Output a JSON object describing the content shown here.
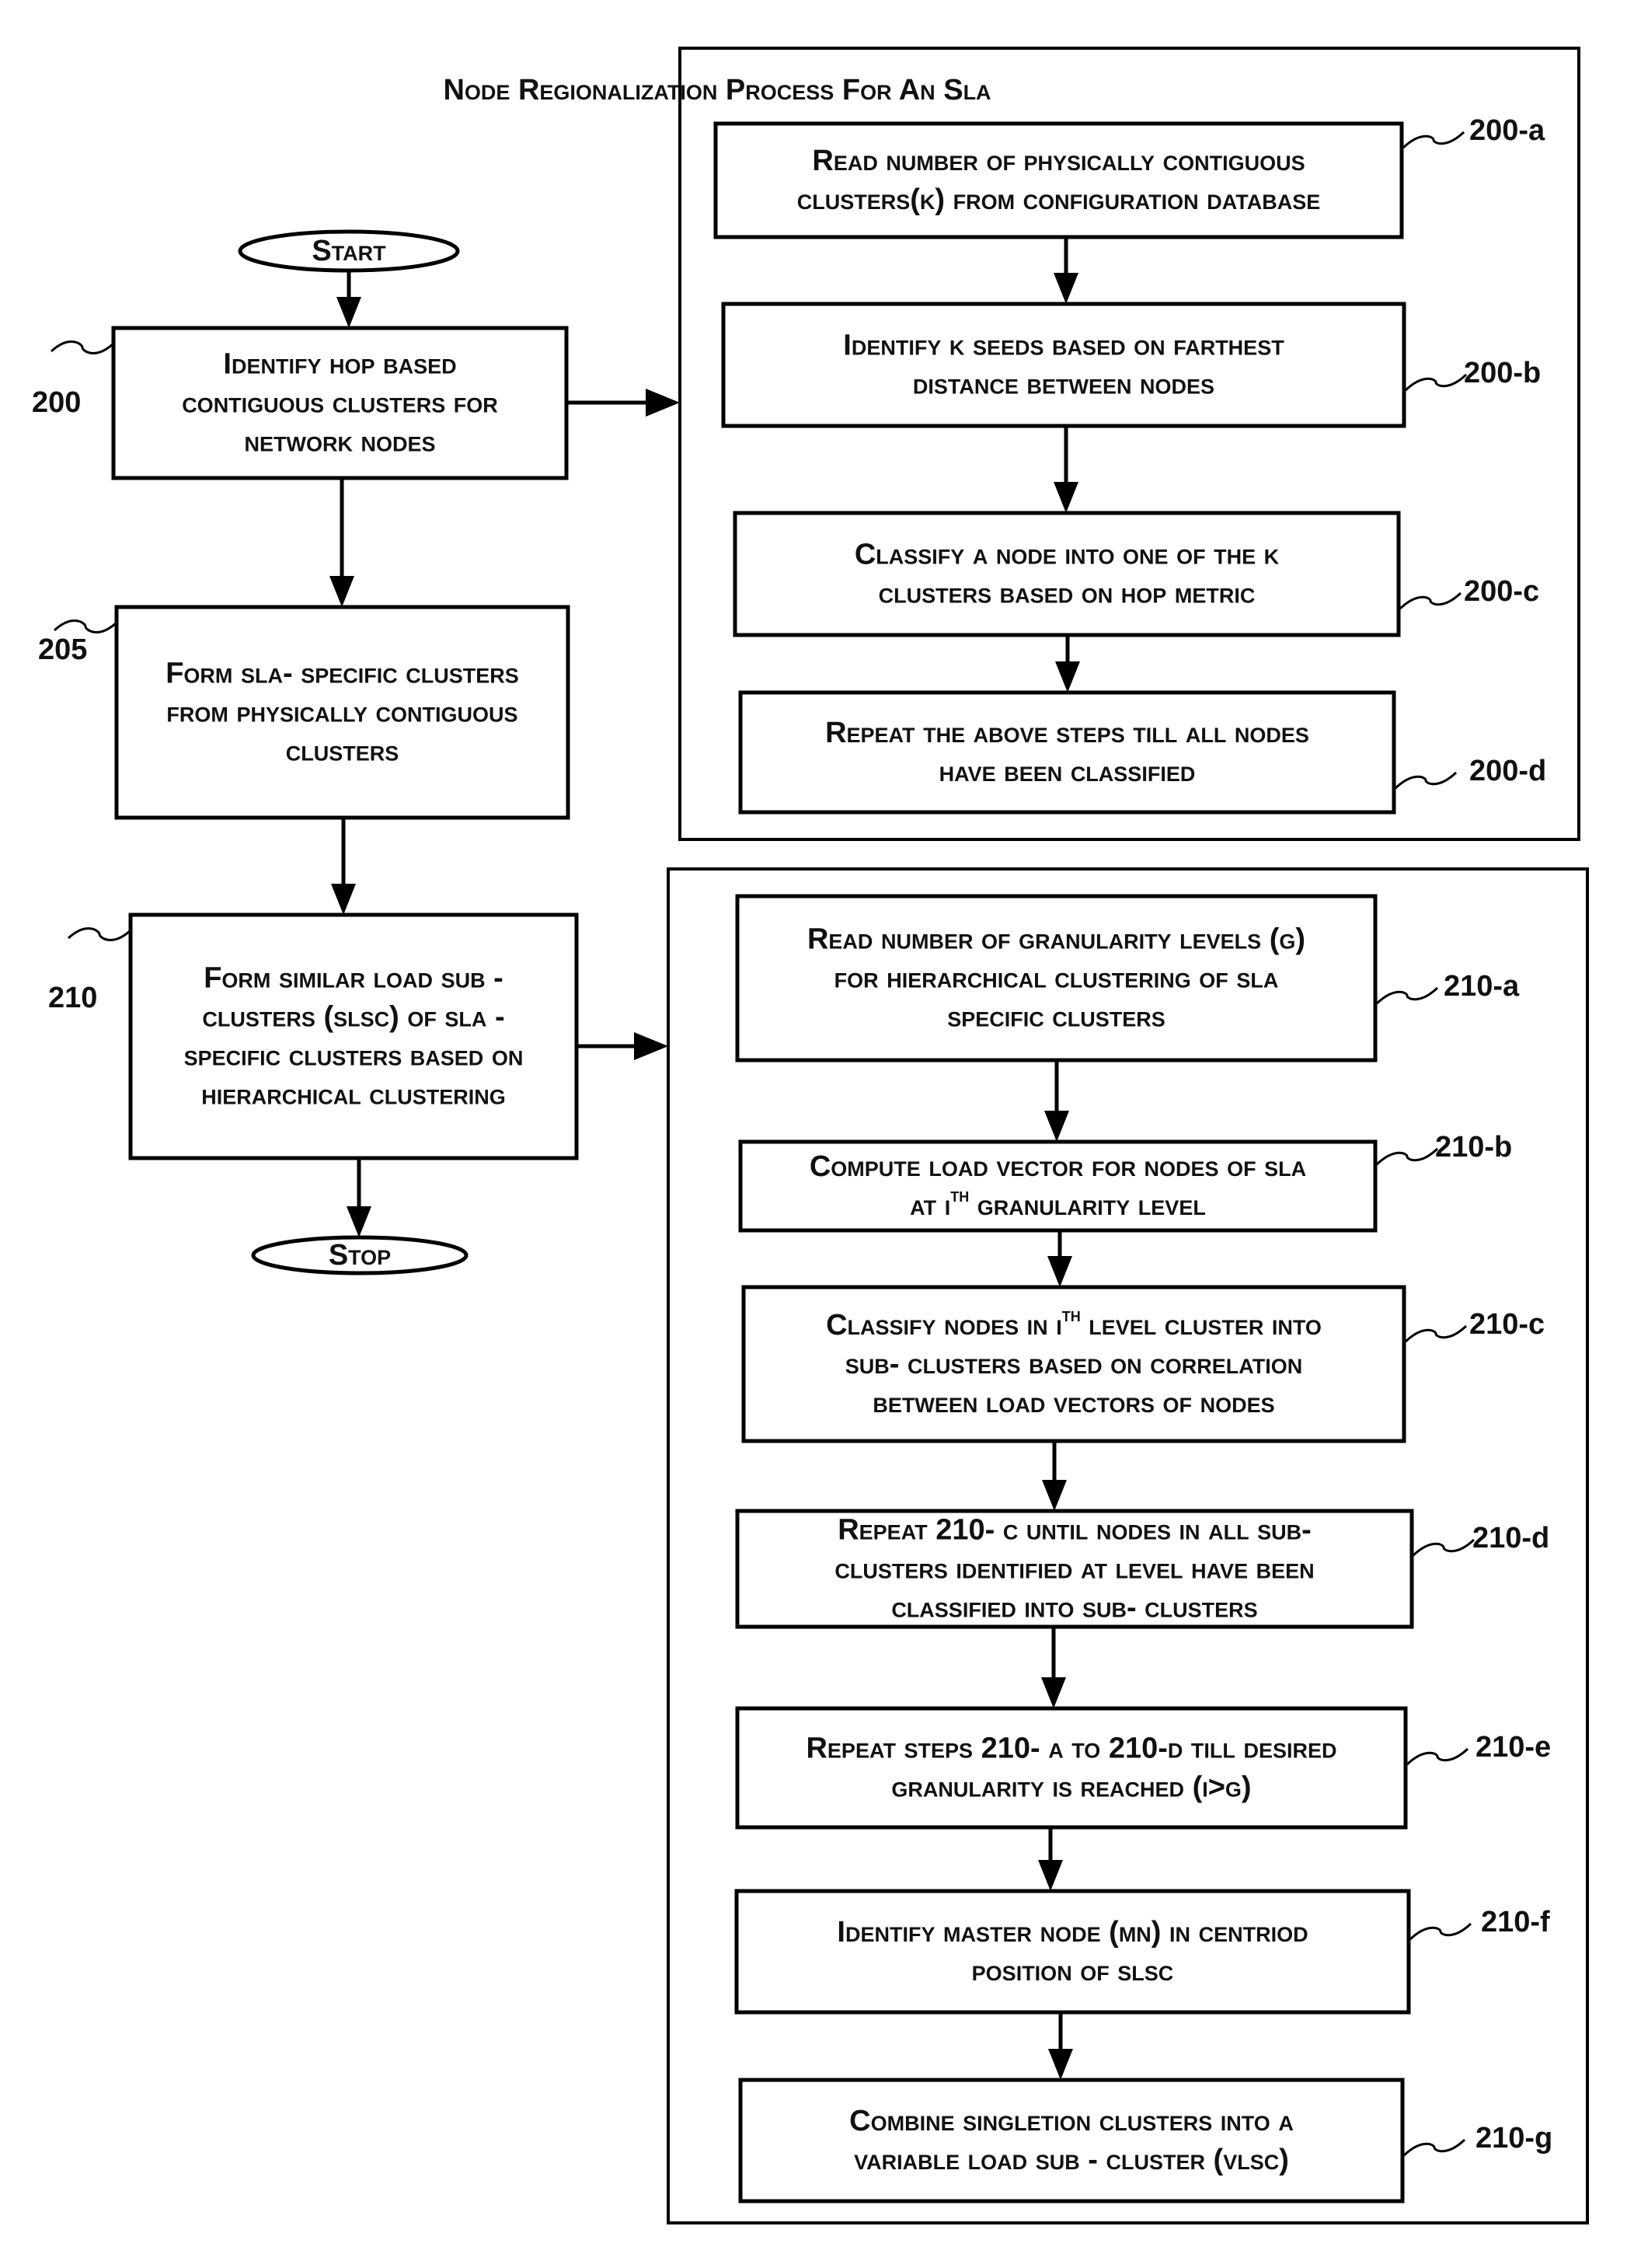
{
  "title": "Node Regionalization Process For An Sla",
  "terminals": {
    "start": "Start",
    "stop": "Stop"
  },
  "main_steps": [
    {
      "ref": "200",
      "lines": [
        "Identify hop based",
        "contiguous clusters for",
        "network nodes"
      ]
    },
    {
      "ref": "205",
      "lines": [
        "Form sla- specific clusters",
        "from physically contiguous",
        "clusters"
      ]
    },
    {
      "ref": "210",
      "lines": [
        "Form similar load sub -",
        "clusters (slsc) of sla -",
        "specific clusters based on",
        "hierarchical clustering"
      ]
    }
  ],
  "group_200_steps": [
    {
      "ref": "200-a",
      "lines": [
        "Read number of physically contiguous",
        "clusters(k) from configuration database"
      ]
    },
    {
      "ref": "200-b",
      "lines": [
        "Identify k seeds based on farthest",
        "distance between nodes"
      ]
    },
    {
      "ref": "200-c",
      "lines": [
        "Classify a node into one of the k",
        "clusters based on hop metric"
      ]
    },
    {
      "ref": "200-d",
      "lines": [
        "Repeat the above steps till all nodes",
        "have been classified"
      ]
    }
  ],
  "group_210_steps": [
    {
      "ref": "210-a",
      "lines": [
        "Read number of granularity levels (g)",
        "for hierarchical clustering of sla",
        "specific clusters"
      ]
    },
    {
      "ref": "210-b",
      "lines": [
        "Compute load vector for nodes of sla",
        "at ith granularity level"
      ]
    },
    {
      "ref": "210-c",
      "lines": [
        "Classify nodes in ith level cluster into",
        "sub- clusters based on correlation",
        "between load vectors of nodes"
      ]
    },
    {
      "ref": "210-d",
      "lines": [
        "Repeat 210- c until nodes in all sub-",
        "clusters identified at level have been",
        "classified into sub- clusters"
      ]
    },
    {
      "ref": "210-e",
      "lines": [
        "Repeat steps 210- a to 210-d till desired",
        "granularity is reached (i>g)"
      ]
    },
    {
      "ref": "210-f",
      "lines": [
        "Identify master node (mn) in centriod",
        "position of slsc"
      ]
    },
    {
      "ref": "210-g",
      "lines": [
        "Combine singletion clusters into a",
        "variable load sub - cluster (vlsc)"
      ]
    }
  ]
}
